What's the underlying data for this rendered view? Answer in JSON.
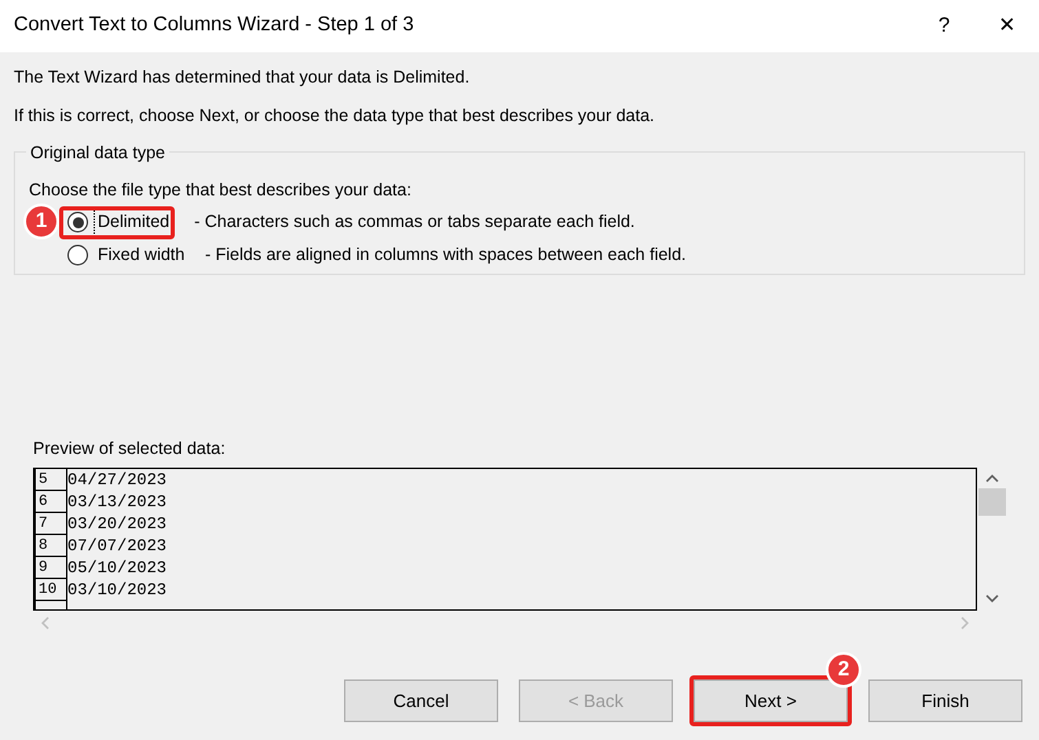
{
  "window": {
    "title": "Convert Text to Columns Wizard - Step 1 of 3",
    "help": "?",
    "close": "✕"
  },
  "intro": [
    "The Text Wizard has determined that your data is Delimited.",
    "If this is correct, choose Next, or choose the data type that best describes your data."
  ],
  "group": {
    "legend": "Original data type",
    "prompt": "Choose the file type that best describes your data:",
    "options": [
      {
        "label": "Delimited",
        "description": "- Characters such as commas or tabs separate each field.",
        "selected": true,
        "callout": "1"
      },
      {
        "label": "Fixed width",
        "description": "- Fields are aligned in columns with spaces between each field.",
        "selected": false
      }
    ]
  },
  "preview": {
    "label": "Preview of selected data:",
    "rows": [
      {
        "number": "5",
        "text": "04/27/2023"
      },
      {
        "number": "6",
        "text": "03/13/2023"
      },
      {
        "number": "7",
        "text": "03/20/2023"
      },
      {
        "number": "8",
        "text": "07/07/2023"
      },
      {
        "number": "9",
        "text": "05/10/2023"
      },
      {
        "number": "10",
        "text": "03/10/2023"
      }
    ]
  },
  "buttons": [
    {
      "label": "Cancel",
      "disabled": false
    },
    {
      "label": "< Back",
      "disabled": true
    },
    {
      "label": "Next >",
      "disabled": false,
      "callout": "2"
    },
    {
      "label": "Finish",
      "disabled": false
    }
  ]
}
